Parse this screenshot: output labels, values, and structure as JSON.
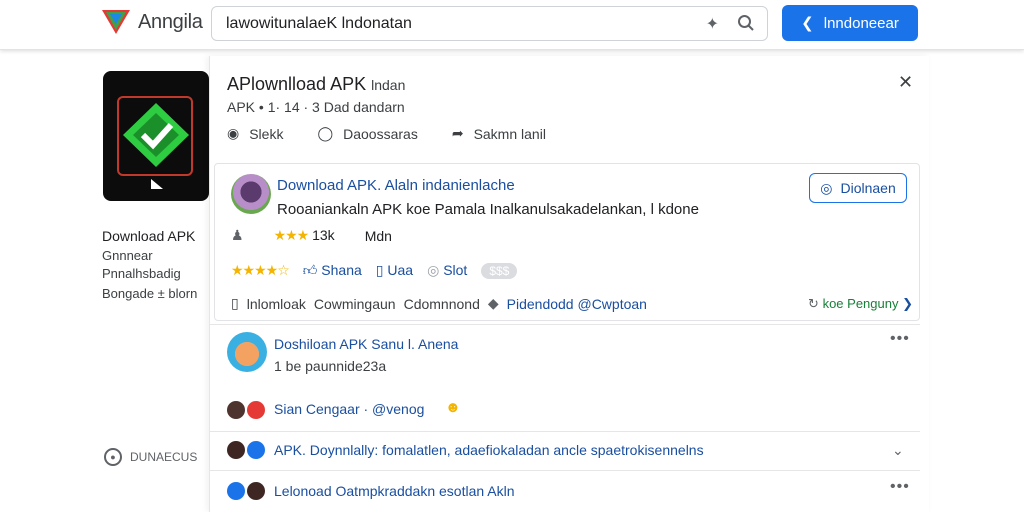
{
  "header": {
    "app_name": "Anngila",
    "search_value": "lawowitunalaeK  lndonatan",
    "primary_button": "lnndoneear",
    "icons": [
      "logo-icon",
      "sparkle-icon",
      "search-icon",
      "back-arrow-icon"
    ]
  },
  "left": {
    "title": "Download APK",
    "lines": [
      "Gnnnear",
      "Pnnalhsbadig",
      "Bongade ± blorn"
    ],
    "footer": "DUNAECUS"
  },
  "panel": {
    "title": "APlownlload APK",
    "title_sub": "lndan",
    "meta": "APK • 1·  14 · 3 Dad dandarn",
    "actions": [
      {
        "icon": "pin-icon",
        "label": "Slekk"
      },
      {
        "icon": "chat-icon",
        "label": "Daoossaras"
      },
      {
        "icon": "share-icon",
        "label": "Sakmn   lanil"
      }
    ]
  },
  "card": {
    "title": "Download APK. Alaln indanienlache",
    "desc": "Rooaniankaln APK koe Pamala  Inalkanulsakadelankan, l kdone",
    "follow": "Diolnaen",
    "rating_text": "13k",
    "rating_label": "Mdn",
    "share": "Shana",
    "save": "Uaa",
    "slot": "Slot",
    "pill": "$$$",
    "row5": [
      "lnlomloak",
      "Cowmingaun",
      "Cdomnnond"
    ],
    "row5_link": "Pidendodd @Cwptoan",
    "row5_right": "koe Penguny"
  },
  "items": [
    {
      "title": "Doshiloan APK Sanu l. Anena",
      "sub": "1 be paunnide23a"
    },
    {
      "title": "Sian  Cengaar · @venog",
      "sub": ""
    },
    {
      "title": "APK. Doynnlally: fomalatlen, adaefiokaladan ancle spaetrokisennelns",
      "sub": ""
    },
    {
      "title": "Lelonoad Oatmpkraddakn esotlan Akln",
      "sub": ""
    }
  ]
}
